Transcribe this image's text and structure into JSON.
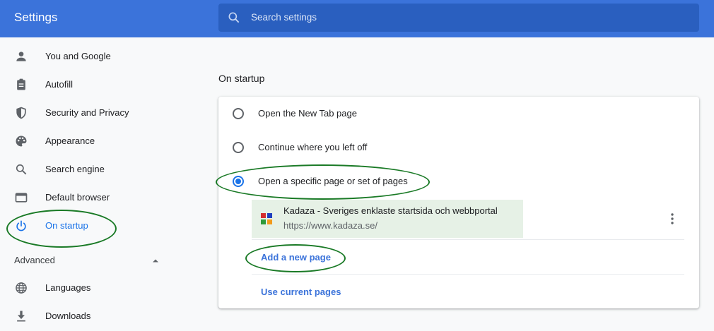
{
  "header": {
    "title": "Settings",
    "search_placeholder": "Search settings"
  },
  "sidebar": {
    "items": [
      {
        "label": "You and Google",
        "icon": "person-icon"
      },
      {
        "label": "Autofill",
        "icon": "clipboard-icon"
      },
      {
        "label": "Security and Privacy",
        "icon": "shield-icon"
      },
      {
        "label": "Appearance",
        "icon": "palette-icon"
      },
      {
        "label": "Search engine",
        "icon": "search-icon"
      },
      {
        "label": "Default browser",
        "icon": "browser-window-icon"
      },
      {
        "label": "On startup",
        "icon": "power-icon",
        "active": true
      }
    ],
    "advanced_label": "Advanced",
    "advanced_items": [
      {
        "label": "Languages",
        "icon": "globe-icon"
      },
      {
        "label": "Downloads",
        "icon": "download-icon"
      }
    ]
  },
  "main": {
    "section_title": "On startup",
    "options": [
      {
        "label": "Open the New Tab page",
        "checked": false
      },
      {
        "label": "Continue where you left off",
        "checked": false
      },
      {
        "label": "Open a specific page or set of pages",
        "checked": true
      }
    ],
    "pages": [
      {
        "title": "Kadaza - Sveriges enklaste startsida och webbportal",
        "url": "https://www.kadaza.se/"
      }
    ],
    "add_page_label": "Add a new page",
    "use_current_label": "Use current pages"
  },
  "colors": {
    "header": "#3b73da",
    "accent": "#1a73e8",
    "annotation_oval": "#1a7a26",
    "page_highlight": "#e6f1e6"
  }
}
